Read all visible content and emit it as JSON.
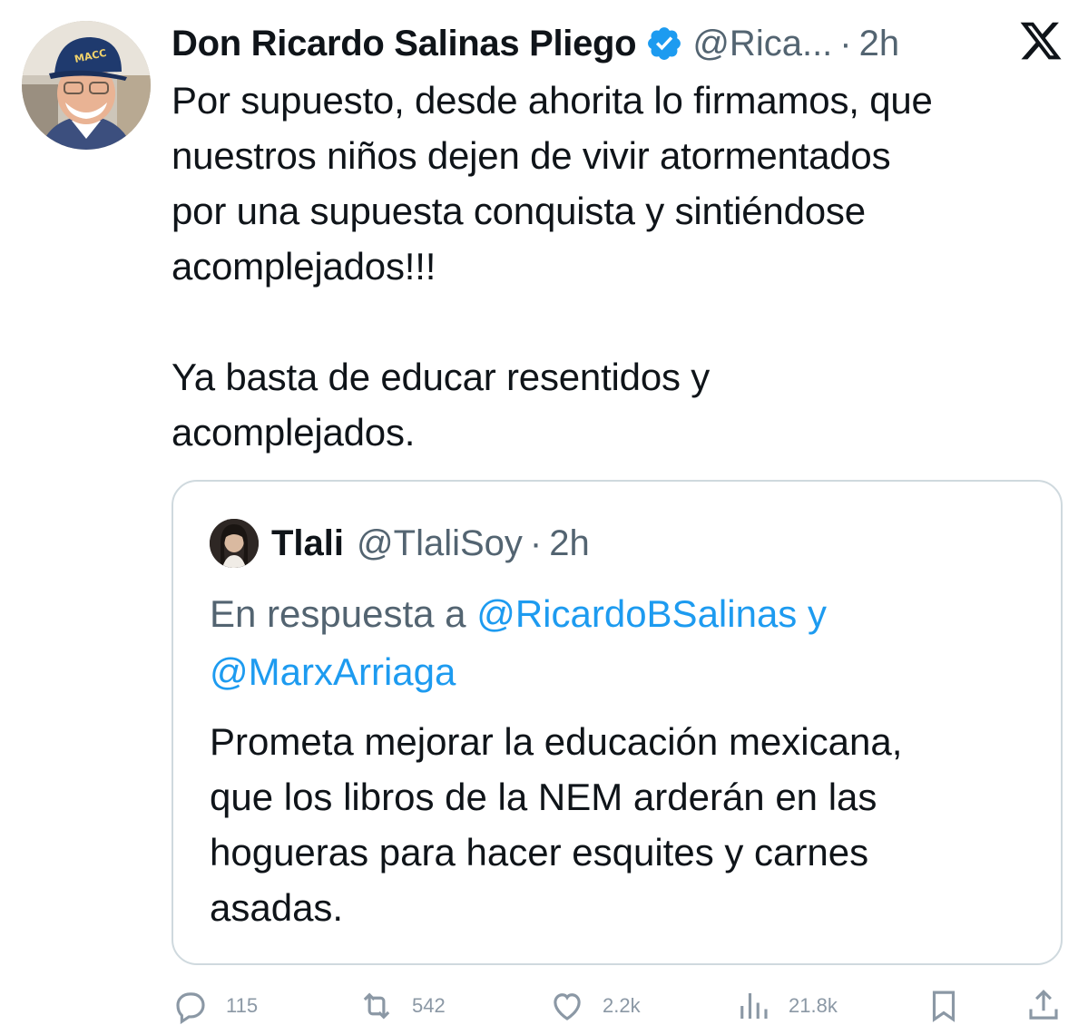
{
  "tweet": {
    "author_name": "Don Ricardo Salinas Pliego",
    "author_handle": "@Rica...",
    "separator": "·",
    "time": "2h",
    "text": "Por supuesto, desde ahorita lo firmamos, que\nnuestros niños dejen de vivir atormentados\npor una supuesta conquista y sintiéndose\nacomplejados!!!\n\nYa basta de educar resentidos y\nacomplejados.",
    "avatar_cap_text": "MACC"
  },
  "quote": {
    "author_name": "Tlali",
    "author_handle": "@TlaliSoy",
    "separator": "·",
    "time": "2h",
    "reply_prefix": "En respuesta a ",
    "reply_mention_1": "@RicardoBSalinas",
    "reply_conjunction": " y",
    "reply_mention_2": "@MarxArriaga",
    "text": "Prometa mejorar la educación mexicana,\nque los libros de la NEM arderán en las\nhogueras para hacer esquites y carnes\nasadas."
  },
  "actions": {
    "replies": "115",
    "reposts": "542",
    "likes": "2.2k",
    "views": "21.8k"
  },
  "icons": {
    "verified": "verified-badge-icon",
    "platform": "x-logo-icon",
    "reply": "reply-icon",
    "repost": "repost-icon",
    "like": "heart-icon",
    "views": "views-icon",
    "bookmark": "bookmark-icon",
    "share": "share-icon"
  },
  "colors": {
    "text": "#0f1419",
    "secondary": "#536471",
    "link": "#1d9bf0",
    "border": "#cfd9de",
    "verified": "#1d9bf0"
  }
}
